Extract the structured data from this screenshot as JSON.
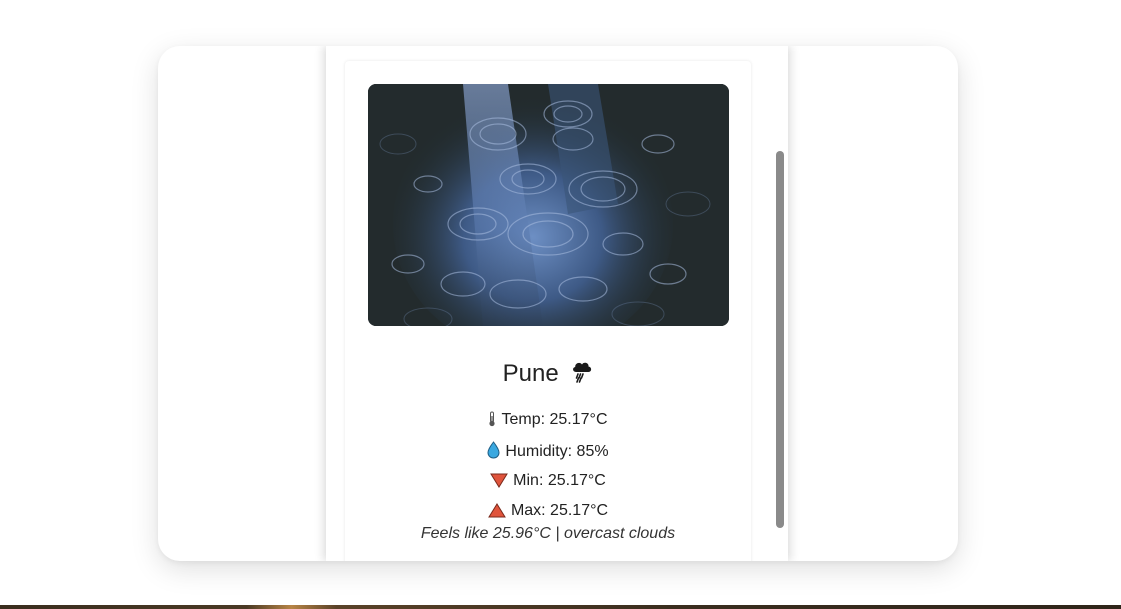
{
  "weather": {
    "city": "Pune",
    "condition_icon": "cloud-rain-icon",
    "temp_label": "Temp: 25.17°C",
    "humidity_label": "Humidity: 85%",
    "min_label": "Min: 25.17°C",
    "max_label": "Max: 25.17°C",
    "feels_like_line": "Feels like 25.96°C | overcast clouds",
    "image": "rain-puddle-photo"
  },
  "icons": {
    "temp": "thermometer-icon",
    "humidity": "droplet-icon",
    "min": "down-triangle-icon",
    "max": "up-triangle-icon"
  },
  "colors": {
    "droplet": "#3aa8e0",
    "triangle": "#e0543c",
    "scrollbar_thumb": "#8a8a8a"
  }
}
